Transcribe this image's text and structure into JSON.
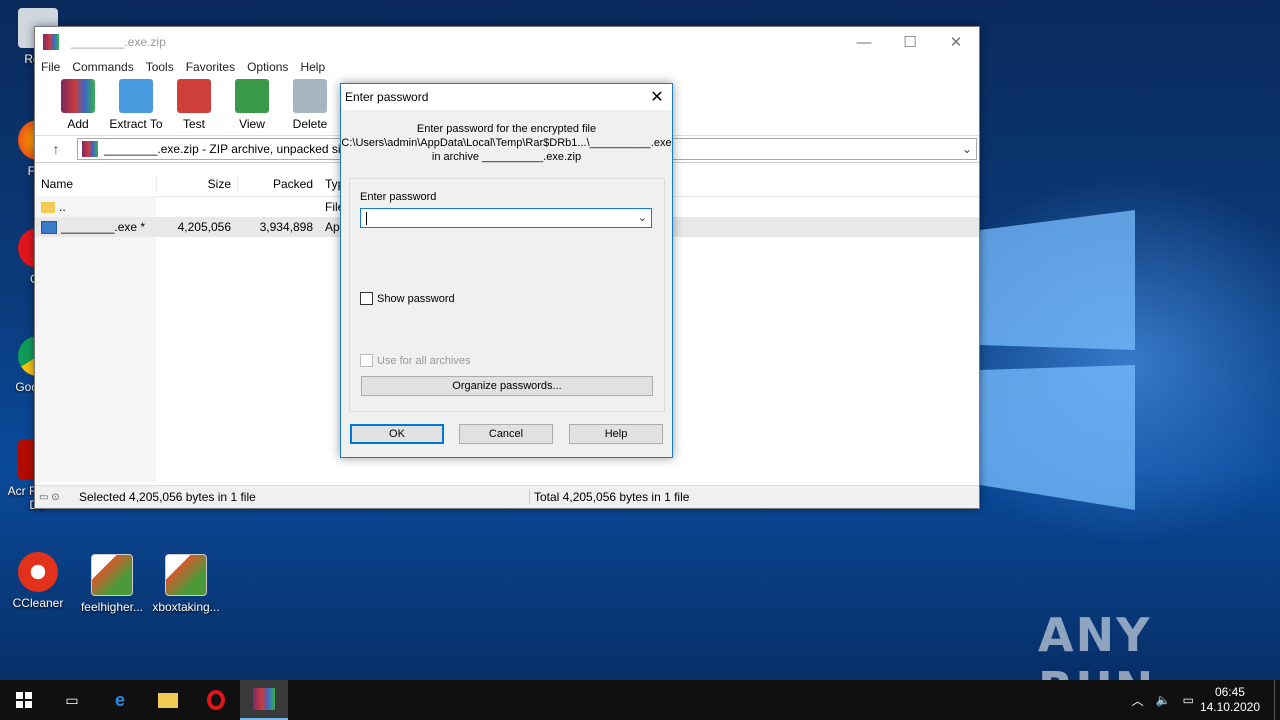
{
  "desktop": {
    "icons": [
      {
        "label": "Recy"
      },
      {
        "label": "Fire"
      },
      {
        "label": "Op"
      },
      {
        "label": "Goo Chr"
      },
      {
        "label": "Acr Reader DC"
      },
      {
        "label": "CCleaner"
      },
      {
        "label": "feelhigher..."
      },
      {
        "label": "xboxtaking..."
      }
    ],
    "watermark": "ANY RUN"
  },
  "winrar": {
    "title": "________.exe.zip",
    "menu": [
      "File",
      "Commands",
      "Tools",
      "Favorites",
      "Options",
      "Help"
    ],
    "toolbar": [
      "Add",
      "Extract To",
      "Test",
      "View",
      "Delete"
    ],
    "path": "________.exe.zip - ZIP archive, unpacked siz",
    "columns": {
      "name": "Name",
      "size": "Size",
      "packed": "Packed",
      "type": "Typ"
    },
    "rows": [
      {
        "name": "..",
        "size": "",
        "packed": "",
        "type": "File"
      },
      {
        "name": "________.exe *",
        "size": "4,205,056",
        "packed": "3,934,898",
        "type": "App"
      }
    ],
    "status_left": "Selected 4,205,056 bytes in 1 file",
    "status_right": "Total 4,205,056 bytes in 1 file"
  },
  "dialog": {
    "title": "Enter password",
    "info_line1": "Enter password for the encrypted file",
    "info_line2": "C:\\Users\\admin\\AppData\\Local\\Temp\\Rar$DRb1...\\__________.exe",
    "info_line3": "in archive __________.exe.zip",
    "password_label": "Enter password",
    "password_value": "",
    "show_password": "Show password",
    "use_for_all": "Use for all archives",
    "organize": "Organize passwords...",
    "ok": "OK",
    "cancel": "Cancel",
    "help": "Help"
  },
  "taskbar": {
    "time": "06:45",
    "date": "14.10.2020"
  }
}
